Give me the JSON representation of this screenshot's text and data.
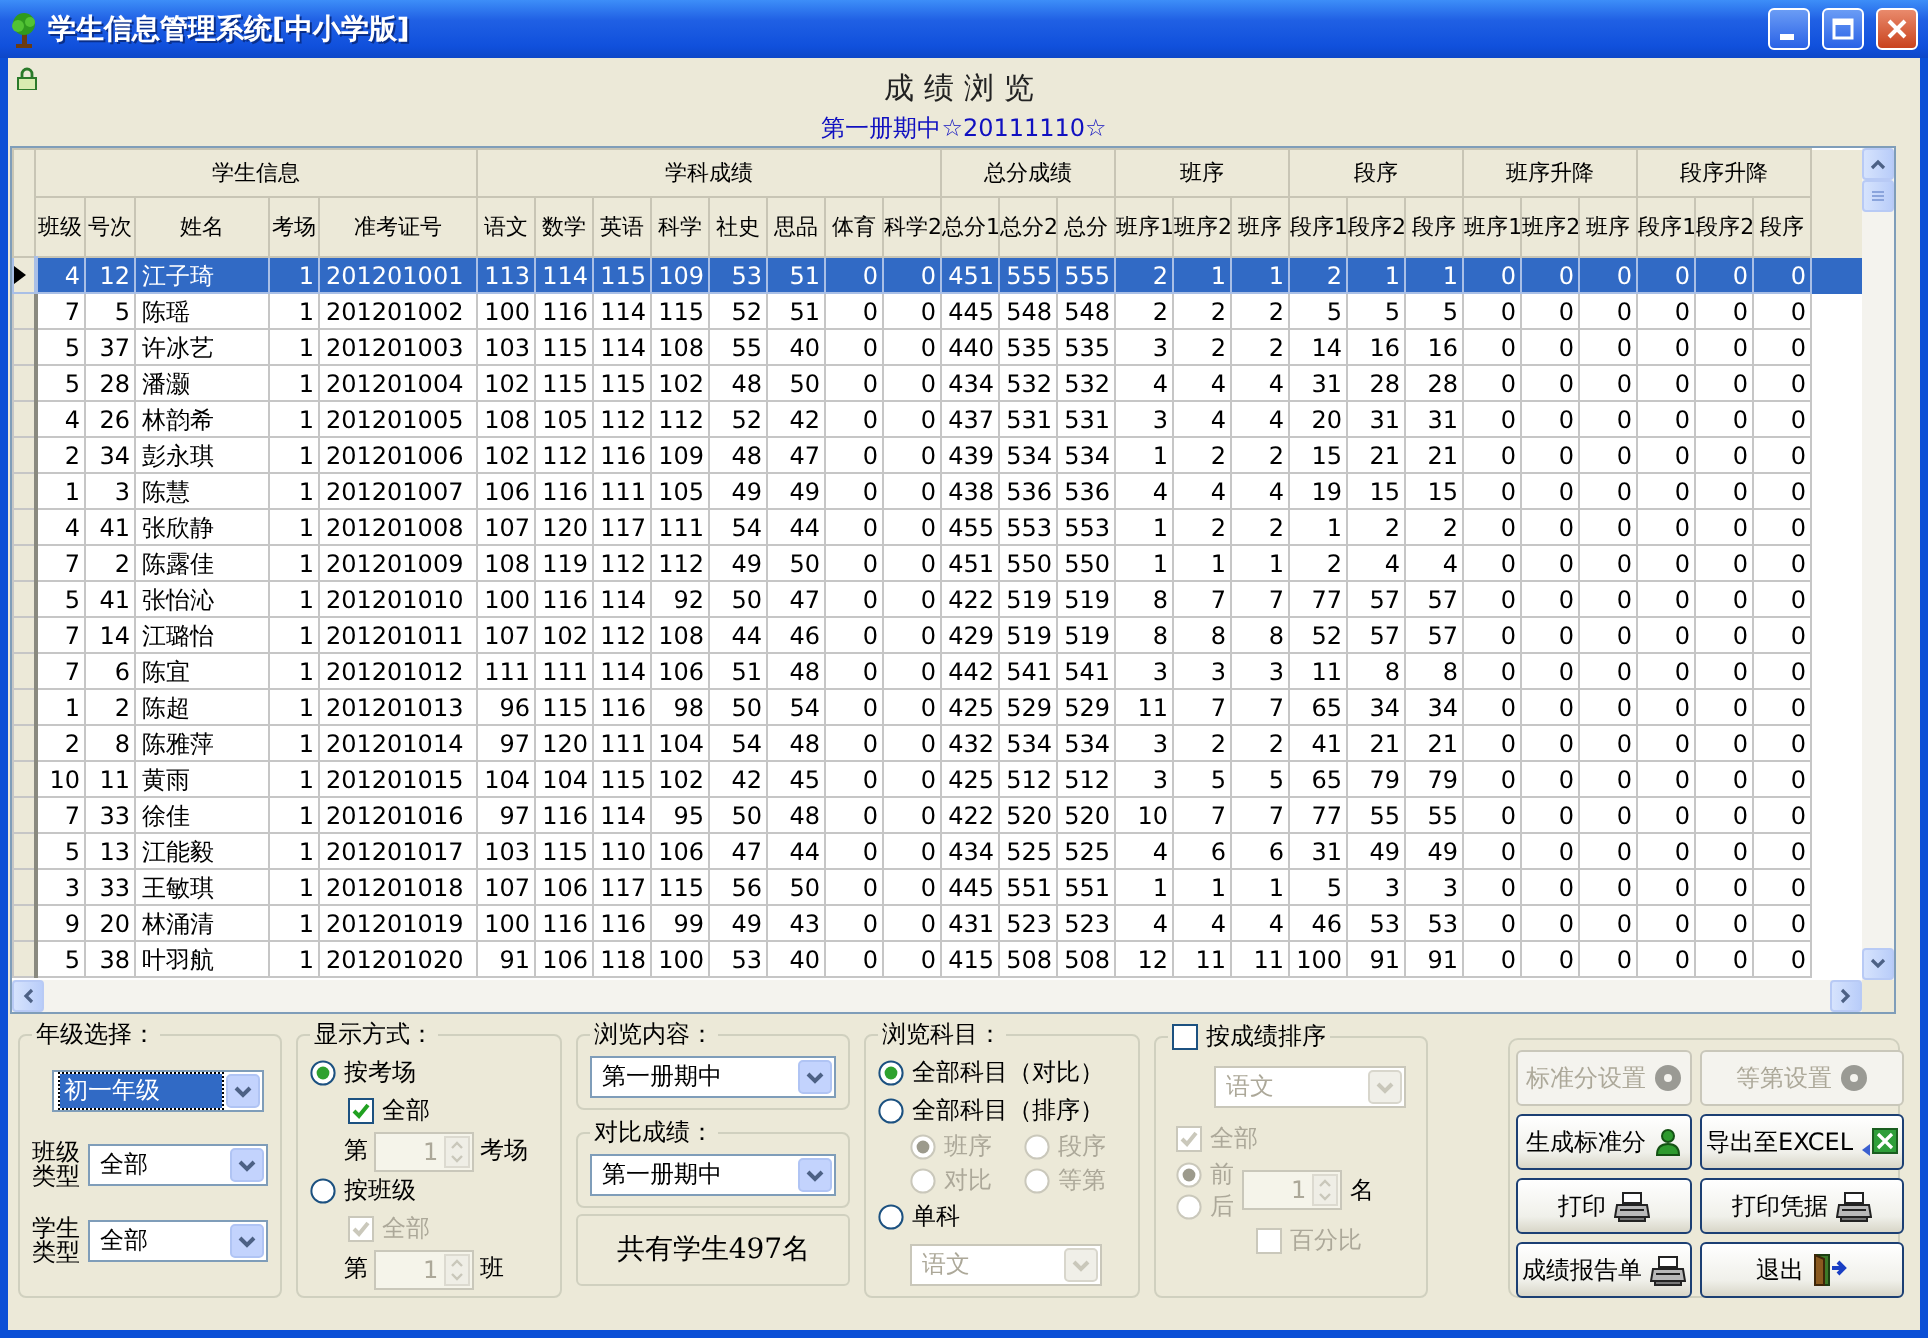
{
  "window": {
    "title": "学生信息管理系统[中小学版]"
  },
  "page": {
    "title": "成绩浏览",
    "subtitle": "第一册期中☆20111110☆"
  },
  "table": {
    "groups": [
      {
        "label": "学生信息",
        "columns": [
          "班级",
          "号次",
          "姓名",
          "考场",
          "准考证号"
        ]
      },
      {
        "label": "学科成绩",
        "columns": [
          "语文",
          "数学",
          "英语",
          "科学",
          "社史",
          "思品",
          "体育",
          "科学2"
        ]
      },
      {
        "label": "总分成绩",
        "columns": [
          "总分1",
          "总分2",
          "总分"
        ]
      },
      {
        "label": "班序",
        "columns": [
          "班序1",
          "班序2",
          "班序"
        ]
      },
      {
        "label": "段序",
        "columns": [
          "段序1",
          "段序2",
          "段序"
        ]
      },
      {
        "label": "班序升降",
        "columns": [
          "班序1",
          "班序2",
          "班序"
        ]
      },
      {
        "label": "段序升降",
        "columns": [
          "段序1",
          "段序2",
          "段序"
        ]
      }
    ],
    "rows": [
      {
        "selected": true,
        "cells": [
          "4",
          "12",
          "江子琦",
          "1",
          "201201001",
          "113",
          "114",
          "115",
          "109",
          "53",
          "51",
          "0",
          "0",
          "451",
          "555",
          "555",
          "2",
          "1",
          "1",
          "2",
          "1",
          "1",
          "0",
          "0",
          "0",
          "0",
          "0",
          "0"
        ]
      },
      {
        "selected": false,
        "cells": [
          "7",
          "5",
          "陈瑶",
          "1",
          "201201002",
          "100",
          "116",
          "114",
          "115",
          "52",
          "51",
          "0",
          "0",
          "445",
          "548",
          "548",
          "2",
          "2",
          "2",
          "5",
          "5",
          "5",
          "0",
          "0",
          "0",
          "0",
          "0",
          "0"
        ]
      },
      {
        "selected": false,
        "cells": [
          "5",
          "37",
          "许冰艺",
          "1",
          "201201003",
          "103",
          "115",
          "114",
          "108",
          "55",
          "40",
          "0",
          "0",
          "440",
          "535",
          "535",
          "3",
          "2",
          "2",
          "14",
          "16",
          "16",
          "0",
          "0",
          "0",
          "0",
          "0",
          "0"
        ]
      },
      {
        "selected": false,
        "cells": [
          "5",
          "28",
          "潘灏",
          "1",
          "201201004",
          "102",
          "115",
          "115",
          "102",
          "48",
          "50",
          "0",
          "0",
          "434",
          "532",
          "532",
          "4",
          "4",
          "4",
          "31",
          "28",
          "28",
          "0",
          "0",
          "0",
          "0",
          "0",
          "0"
        ]
      },
      {
        "selected": false,
        "cells": [
          "4",
          "26",
          "林韵希",
          "1",
          "201201005",
          "108",
          "105",
          "112",
          "112",
          "52",
          "42",
          "0",
          "0",
          "437",
          "531",
          "531",
          "3",
          "4",
          "4",
          "20",
          "31",
          "31",
          "0",
          "0",
          "0",
          "0",
          "0",
          "0"
        ]
      },
      {
        "selected": false,
        "cells": [
          "2",
          "34",
          "彭永琪",
          "1",
          "201201006",
          "102",
          "112",
          "116",
          "109",
          "48",
          "47",
          "0",
          "0",
          "439",
          "534",
          "534",
          "1",
          "2",
          "2",
          "15",
          "21",
          "21",
          "0",
          "0",
          "0",
          "0",
          "0",
          "0"
        ]
      },
      {
        "selected": false,
        "cells": [
          "1",
          "3",
          "陈慧",
          "1",
          "201201007",
          "106",
          "116",
          "111",
          "105",
          "49",
          "49",
          "0",
          "0",
          "438",
          "536",
          "536",
          "4",
          "4",
          "4",
          "19",
          "15",
          "15",
          "0",
          "0",
          "0",
          "0",
          "0",
          "0"
        ]
      },
      {
        "selected": false,
        "cells": [
          "4",
          "41",
          "张欣静",
          "1",
          "201201008",
          "107",
          "120",
          "117",
          "111",
          "54",
          "44",
          "0",
          "0",
          "455",
          "553",
          "553",
          "1",
          "2",
          "2",
          "1",
          "2",
          "2",
          "0",
          "0",
          "0",
          "0",
          "0",
          "0"
        ]
      },
      {
        "selected": false,
        "cells": [
          "7",
          "2",
          "陈露佳",
          "1",
          "201201009",
          "108",
          "119",
          "112",
          "112",
          "49",
          "50",
          "0",
          "0",
          "451",
          "550",
          "550",
          "1",
          "1",
          "1",
          "2",
          "4",
          "4",
          "0",
          "0",
          "0",
          "0",
          "0",
          "0"
        ]
      },
      {
        "selected": false,
        "cells": [
          "5",
          "41",
          "张怡沁",
          "1",
          "201201010",
          "100",
          "116",
          "114",
          "92",
          "50",
          "47",
          "0",
          "0",
          "422",
          "519",
          "519",
          "8",
          "7",
          "7",
          "77",
          "57",
          "57",
          "0",
          "0",
          "0",
          "0",
          "0",
          "0"
        ]
      },
      {
        "selected": false,
        "cells": [
          "7",
          "14",
          "江璐怡",
          "1",
          "201201011",
          "107",
          "102",
          "112",
          "108",
          "44",
          "46",
          "0",
          "0",
          "429",
          "519",
          "519",
          "8",
          "8",
          "8",
          "52",
          "57",
          "57",
          "0",
          "0",
          "0",
          "0",
          "0",
          "0"
        ]
      },
      {
        "selected": false,
        "cells": [
          "7",
          "6",
          "陈宜",
          "1",
          "201201012",
          "111",
          "111",
          "114",
          "106",
          "51",
          "48",
          "0",
          "0",
          "442",
          "541",
          "541",
          "3",
          "3",
          "3",
          "11",
          "8",
          "8",
          "0",
          "0",
          "0",
          "0",
          "0",
          "0"
        ]
      },
      {
        "selected": false,
        "cells": [
          "1",
          "2",
          "陈超",
          "1",
          "201201013",
          "96",
          "115",
          "116",
          "98",
          "50",
          "54",
          "0",
          "0",
          "425",
          "529",
          "529",
          "11",
          "7",
          "7",
          "65",
          "34",
          "34",
          "0",
          "0",
          "0",
          "0",
          "0",
          "0"
        ]
      },
      {
        "selected": false,
        "cells": [
          "2",
          "8",
          "陈雅萍",
          "1",
          "201201014",
          "97",
          "120",
          "111",
          "104",
          "54",
          "48",
          "0",
          "0",
          "432",
          "534",
          "534",
          "3",
          "2",
          "2",
          "41",
          "21",
          "21",
          "0",
          "0",
          "0",
          "0",
          "0",
          "0"
        ]
      },
      {
        "selected": false,
        "cells": [
          "10",
          "11",
          "黄雨",
          "1",
          "201201015",
          "104",
          "104",
          "115",
          "102",
          "42",
          "45",
          "0",
          "0",
          "425",
          "512",
          "512",
          "3",
          "5",
          "5",
          "65",
          "79",
          "79",
          "0",
          "0",
          "0",
          "0",
          "0",
          "0"
        ]
      },
      {
        "selected": false,
        "cells": [
          "7",
          "33",
          "徐佳",
          "1",
          "201201016",
          "97",
          "116",
          "114",
          "95",
          "50",
          "48",
          "0",
          "0",
          "422",
          "520",
          "520",
          "10",
          "7",
          "7",
          "77",
          "55",
          "55",
          "0",
          "0",
          "0",
          "0",
          "0",
          "0"
        ]
      },
      {
        "selected": false,
        "cells": [
          "5",
          "13",
          "江能毅",
          "1",
          "201201017",
          "103",
          "115",
          "110",
          "106",
          "47",
          "44",
          "0",
          "0",
          "434",
          "525",
          "525",
          "4",
          "6",
          "6",
          "31",
          "49",
          "49",
          "0",
          "0",
          "0",
          "0",
          "0",
          "0"
        ]
      },
      {
        "selected": false,
        "cells": [
          "3",
          "33",
          "王敏琪",
          "1",
          "201201018",
          "107",
          "106",
          "117",
          "115",
          "56",
          "50",
          "0",
          "0",
          "445",
          "551",
          "551",
          "1",
          "1",
          "1",
          "5",
          "3",
          "3",
          "0",
          "0",
          "0",
          "0",
          "0",
          "0"
        ]
      },
      {
        "selected": false,
        "cells": [
          "9",
          "20",
          "林涌清",
          "1",
          "201201019",
          "100",
          "116",
          "116",
          "99",
          "49",
          "43",
          "0",
          "0",
          "431",
          "523",
          "523",
          "4",
          "4",
          "4",
          "46",
          "53",
          "53",
          "0",
          "0",
          "0",
          "0",
          "0",
          "0"
        ]
      },
      {
        "selected": false,
        "cells": [
          "5",
          "38",
          "叶羽航",
          "1",
          "201201020",
          "91",
          "106",
          "118",
          "100",
          "53",
          "40",
          "0",
          "0",
          "415",
          "508",
          "508",
          "12",
          "11",
          "11",
          "100",
          "91",
          "91",
          "0",
          "0",
          "0",
          "0",
          "0",
          "0"
        ]
      }
    ]
  },
  "grade_filter": {
    "label": "年级选择：",
    "grade": "初一年级",
    "grade_focused": true,
    "class_type_label": "班级类型",
    "class_type": "全部",
    "student_type_label": "学生类型",
    "student_type": "全部"
  },
  "display_mode": {
    "label": "显示方式：",
    "options": [
      {
        "label": "按考场",
        "selected": true,
        "all": {
          "label": "全部",
          "checked": true
        },
        "prefix": "第",
        "number": "1",
        "suffix": "考场"
      },
      {
        "label": "按班级",
        "selected": false,
        "all": {
          "label": "全部",
          "checked": true
        },
        "prefix": "第",
        "number": "1",
        "suffix": "班"
      }
    ]
  },
  "browse": {
    "content_label": "浏览内容：",
    "content": "第一册期中",
    "compare_label": "对比成绩：",
    "compare": "第一册期中",
    "count": "共有学生497名"
  },
  "subjects": {
    "label": "浏览科目：",
    "options": [
      {
        "label": "全部科目（对比）",
        "selected": true
      },
      {
        "label": "全部科目（排序）",
        "selected": false,
        "sub_options": [
          {
            "label": "班序",
            "selected": true
          },
          {
            "label": "段序",
            "selected": false
          },
          {
            "label": "对比",
            "selected": false
          },
          {
            "label": "等第",
            "selected": false
          }
        ]
      },
      {
        "label": "单科",
        "selected": false,
        "subject": "语文"
      }
    ]
  },
  "sort": {
    "label": "按成绩排序",
    "checked": false,
    "subject": "语文",
    "all": {
      "label": "全部",
      "checked": true
    },
    "directions": [
      {
        "label": "前",
        "selected": true
      },
      {
        "label": "后",
        "selected": false
      }
    ],
    "count": "1",
    "unit": "名",
    "percent": {
      "label": "百分比",
      "checked": false
    }
  },
  "buttons": [
    {
      "label": "标准分设置",
      "kind": "disc",
      "disabled": true
    },
    {
      "label": "等第设置",
      "kind": "disc",
      "disabled": true
    },
    {
      "label": "生成标准分",
      "kind": "person",
      "disabled": false
    },
    {
      "label": "导出至EXCEL",
      "kind": "sheet",
      "disabled": false
    },
    {
      "label": "打印",
      "kind": "printer",
      "disabled": false
    },
    {
      "label": "打印凭据",
      "kind": "printer",
      "disabled": false
    },
    {
      "label": "成绩报告单",
      "kind": "printer",
      "disabled": false
    },
    {
      "label": "退出",
      "kind": "door",
      "disabled": false
    }
  ]
}
